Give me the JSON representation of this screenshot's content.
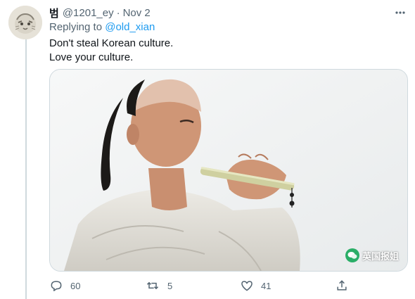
{
  "tweet": {
    "display_name": "범",
    "handle": "@1201_ey",
    "separator": "·",
    "date": "Nov 2",
    "replying_prefix": "Replying to",
    "replying_to": "@old_xian",
    "text_lines": [
      "Don't steal Korean culture.",
      "Love your culture."
    ],
    "image_icon": "photo-man-playing-flute"
  },
  "actions": {
    "reply_count": "60",
    "retweet_count": "5",
    "like_count": "41"
  },
  "watermark": {
    "text": "英国报姐"
  },
  "colors": {
    "accent": "#1d9bf0",
    "muted": "#536471",
    "text": "#0f1419",
    "border": "#cfd9de"
  }
}
